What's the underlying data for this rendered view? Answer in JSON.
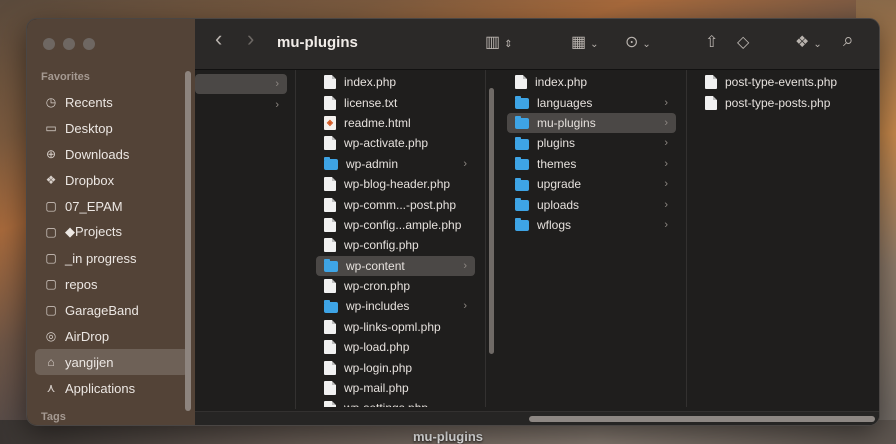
{
  "window_title": "mu-plugins",
  "desktop_label": "mu-plugins",
  "sidebar": {
    "favorites_heading": "Favorites",
    "tags_heading": "Tags",
    "items": [
      {
        "label": "Recents",
        "icon": "clock-icon",
        "selected": false
      },
      {
        "label": "Desktop",
        "icon": "desktop-icon",
        "selected": false
      },
      {
        "label": "Downloads",
        "icon": "download-icon",
        "selected": false
      },
      {
        "label": "Dropbox",
        "icon": "dropbox-icon",
        "selected": false
      },
      {
        "label": "07_EPAM",
        "icon": "folder-icon",
        "selected": false
      },
      {
        "label": "◆Projects",
        "icon": "folder-icon",
        "selected": false
      },
      {
        "label": "_in progress",
        "icon": "folder-icon",
        "selected": false
      },
      {
        "label": "repos",
        "icon": "folder-icon",
        "selected": false
      },
      {
        "label": "GarageBand",
        "icon": "folder-icon",
        "selected": false
      },
      {
        "label": "AirDrop",
        "icon": "airdrop-icon",
        "selected": false
      },
      {
        "label": "yangijen",
        "icon": "home-icon",
        "selected": true
      },
      {
        "label": "Applications",
        "icon": "applications-icon",
        "selected": false
      }
    ]
  },
  "toolbar": {
    "back": "‹",
    "forward": "›",
    "view": "▥",
    "group": "▦",
    "action": "⊙",
    "share": "⇧",
    "tag": "◇",
    "dropbox": "❖",
    "search": "⌕"
  },
  "columns": {
    "col1": [
      {
        "label": "",
        "type": "folder",
        "chevron": true,
        "selected": true
      },
      {
        "label": "",
        "type": "folder",
        "chevron": true,
        "selected": false
      }
    ],
    "col2": [
      {
        "label": "index.php",
        "type": "doc",
        "chevron": false,
        "selected": false
      },
      {
        "label": "license.txt",
        "type": "doc",
        "chevron": false,
        "selected": false
      },
      {
        "label": "readme.html",
        "type": "html",
        "chevron": false,
        "selected": false
      },
      {
        "label": "wp-activate.php",
        "type": "doc",
        "chevron": false,
        "selected": false
      },
      {
        "label": "wp-admin",
        "type": "folder",
        "chevron": true,
        "selected": false
      },
      {
        "label": "wp-blog-header.php",
        "type": "doc",
        "chevron": false,
        "selected": false
      },
      {
        "label": "wp-comm...-post.php",
        "type": "doc",
        "chevron": false,
        "selected": false
      },
      {
        "label": "wp-config...ample.php",
        "type": "doc",
        "chevron": false,
        "selected": false
      },
      {
        "label": "wp-config.php",
        "type": "doc",
        "chevron": false,
        "selected": false
      },
      {
        "label": "wp-content",
        "type": "folder",
        "chevron": true,
        "selected": true
      },
      {
        "label": "wp-cron.php",
        "type": "doc",
        "chevron": false,
        "selected": false
      },
      {
        "label": "wp-includes",
        "type": "folder",
        "chevron": true,
        "selected": false
      },
      {
        "label": "wp-links-opml.php",
        "type": "doc",
        "chevron": false,
        "selected": false
      },
      {
        "label": "wp-load.php",
        "type": "doc",
        "chevron": false,
        "selected": false
      },
      {
        "label": "wp-login.php",
        "type": "doc",
        "chevron": false,
        "selected": false
      },
      {
        "label": "wp-mail.php",
        "type": "doc",
        "chevron": false,
        "selected": false
      },
      {
        "label": "wp-settings.php",
        "type": "doc",
        "chevron": false,
        "selected": false
      }
    ],
    "col3": [
      {
        "label": "index.php",
        "type": "doc",
        "chevron": false,
        "selected": false
      },
      {
        "label": "languages",
        "type": "folder",
        "chevron": true,
        "selected": false
      },
      {
        "label": "mu-plugins",
        "type": "folder",
        "chevron": true,
        "selected": true
      },
      {
        "label": "plugins",
        "type": "folder",
        "chevron": true,
        "selected": false
      },
      {
        "label": "themes",
        "type": "folder",
        "chevron": true,
        "selected": false
      },
      {
        "label": "upgrade",
        "type": "folder",
        "chevron": true,
        "selected": false
      },
      {
        "label": "uploads",
        "type": "folder",
        "chevron": true,
        "selected": false
      },
      {
        "label": "wflogs",
        "type": "folder",
        "chevron": true,
        "selected": false
      }
    ],
    "col4": [
      {
        "label": "post-type-events.php",
        "type": "doc",
        "chevron": false,
        "selected": false
      },
      {
        "label": "post-type-posts.php",
        "type": "doc",
        "chevron": false,
        "selected": false
      }
    ]
  }
}
